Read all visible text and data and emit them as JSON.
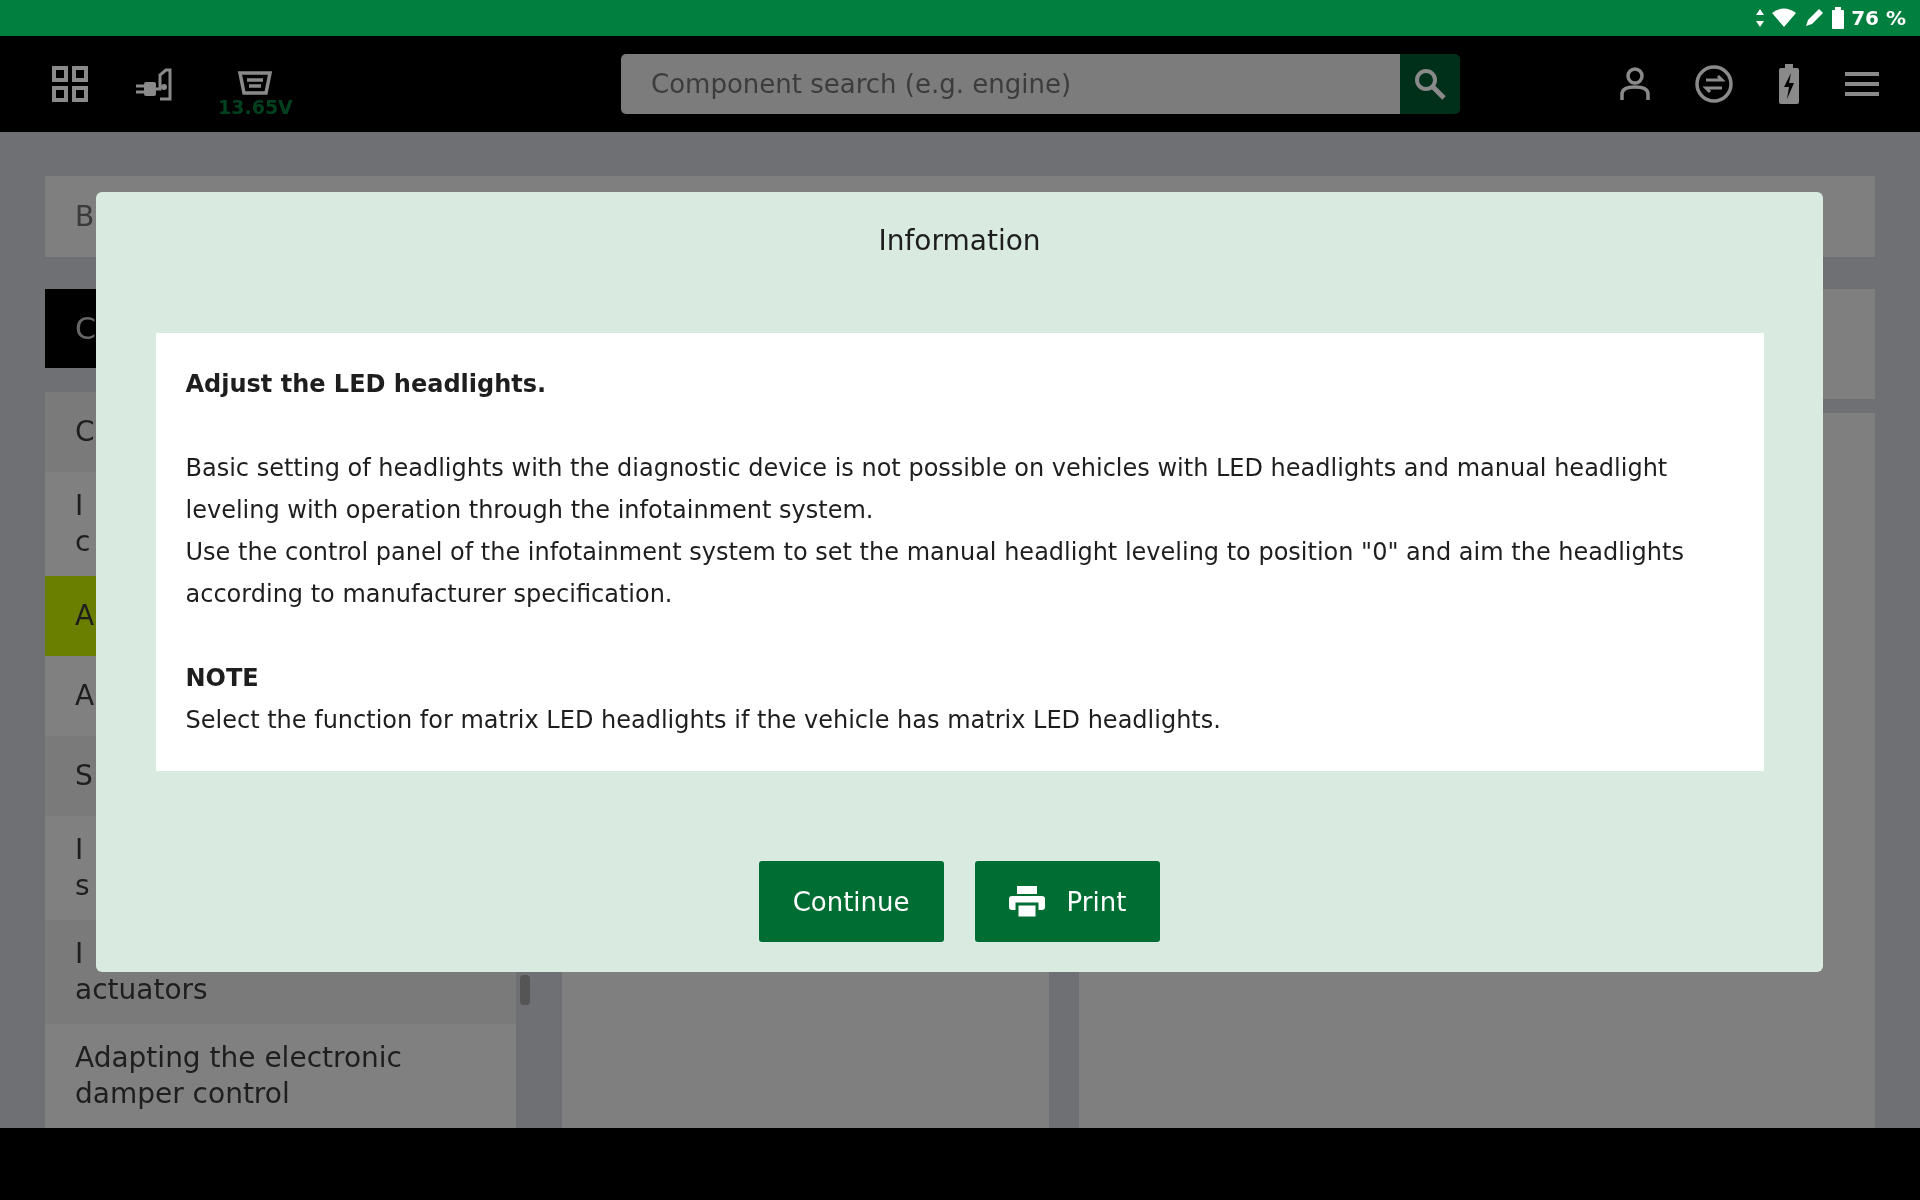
{
  "status_bar": {
    "battery": "76 %"
  },
  "top_bar": {
    "voltage": "13.65V",
    "search": {
      "placeholder": "Component search (e.g. engine)"
    }
  },
  "background": {
    "breadcrumb": "B",
    "list_header": "C",
    "list_items": [
      {
        "lines": [
          "C"
        ],
        "selected": false
      },
      {
        "lines": [
          "I",
          "c"
        ],
        "selected": false
      },
      {
        "lines": [
          "A"
        ],
        "selected": true
      },
      {
        "lines": [
          "A"
        ],
        "selected": false
      },
      {
        "lines": [
          "S"
        ],
        "selected": false
      },
      {
        "lines": [
          "I",
          "s"
        ],
        "selected": false
      },
      {
        "lines": [
          "I",
          "actuators"
        ],
        "selected": false
      },
      {
        "lines": [
          "Adapting the electronic",
          "damper control"
        ],
        "selected": false
      }
    ]
  },
  "dialog": {
    "title": "Information",
    "heading": "Adjust the LED headlights.",
    "paragraphs": [
      "Basic setting of headlights with the diagnostic device is not possible on vehicles with LED headlights and manual headlight leveling with operation through the infotainment system.",
      "Use the control panel of the infotainment system to set the manual headlight leveling to position \"0\" and aim the headlights according to manufacturer specification."
    ],
    "note_label": "NOTE",
    "note": "Select the function for matrix LED headlights if the vehicle has matrix LED headlights.",
    "buttons": [
      {
        "label": "Continue",
        "kind": "primary"
      },
      {
        "label": "Print",
        "kind": "print"
      }
    ]
  }
}
